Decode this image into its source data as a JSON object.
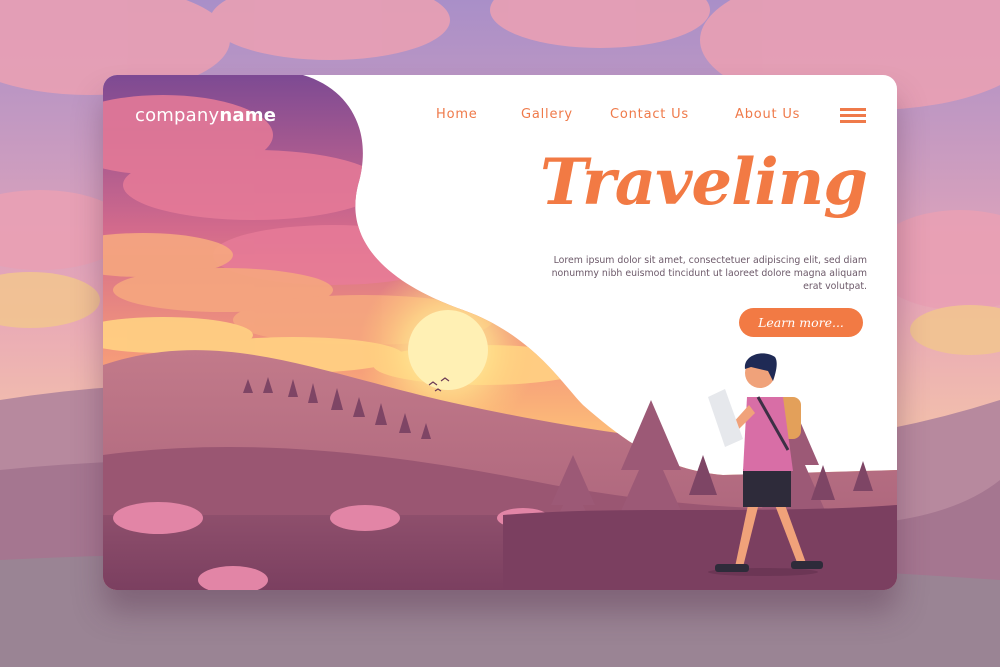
{
  "brand": {
    "name_light": "company",
    "name_bold": "name"
  },
  "nav": {
    "items": [
      {
        "label": "Home"
      },
      {
        "label": "Gallery"
      },
      {
        "label": "Contact Us"
      },
      {
        "label": "About Us"
      }
    ],
    "menu_icon": "hamburger-icon"
  },
  "hero": {
    "title": "Traveling",
    "body": "Lorem ipsum dolor sit amet, consectetuer adipiscing elit, sed diam nonummy nibh euismod tincidunt ut laoreet dolore magna aliquam erat volutpat.",
    "cta_label": "Learn more..."
  },
  "colors": {
    "accent": "#f27a44",
    "nav_text": "#ef7a4a",
    "body_text": "#6d5a6a",
    "sky_top": "#8a5a9c",
    "sky_glow": "#ffd27a",
    "sun": "#fff2b0",
    "hills": "#a0607a"
  }
}
